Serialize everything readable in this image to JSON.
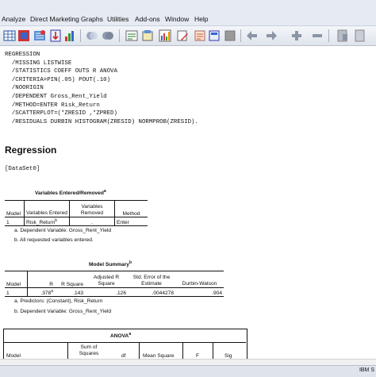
{
  "menu": [
    "Analyze",
    "Direct Marketing",
    "Graphs",
    "Utilities",
    "Add-ons",
    "Window",
    "Help"
  ],
  "syntax": [
    "REGRESSION",
    "  /MISSING LISTWISE",
    "  /STATISTICS COEFF OUTS R ANOVA",
    "  /CRITERIA=PIN(.05) POUT(.10)",
    "  /NOORIGIN",
    "  /DEPENDENT Gross_Rent_Yield",
    "  /METHOD=ENTER Risk_Return",
    "  /SCATTERPLOT=(*ZRESID ,*ZPRED)",
    "  /RESIDUALS DURBIN HISTOGRAM(ZRESID) NORMPROB(ZRESID)."
  ],
  "heading": "Regression",
  "dataset": "[DataSet0]",
  "vars_table": {
    "title": "Variables Entered/Removed",
    "title_sup": "a",
    "headers": [
      "Model",
      "Variables Entered",
      "Variables Removed",
      "Method"
    ],
    "row": {
      "model": "1",
      "entered": "Risk_Return",
      "entered_sup": "b",
      "removed": ".",
      "method": "Enter"
    },
    "notes": [
      "a. Dependent Variable: Gross_Rent_Yield",
      "b. All requested variables entered."
    ]
  },
  "summary_table": {
    "title": "Model Summary",
    "title_sup": "b",
    "headers": [
      "Model",
      "R",
      "R Square",
      "Adjusted R Square",
      "Std. Error of the Estimate",
      "Durbin-Watson"
    ],
    "row": {
      "model": "1",
      "r": ".378",
      "r_sup": "a",
      "r2": ".143",
      "adj_r2": ".126",
      "se": ".0044278",
      "dw": ".904"
    },
    "notes": [
      "a. Predictors: (Constant), Risk_Return",
      "b. Dependent Variable: Gross_Rent_Yield"
    ]
  },
  "anova_table": {
    "title": "ANOVA",
    "title_sup": "a",
    "headers": [
      "Model",
      "Sum of Squares",
      "df",
      "Mean Square",
      "F",
      "Sig"
    ]
  },
  "status": "IBM S"
}
